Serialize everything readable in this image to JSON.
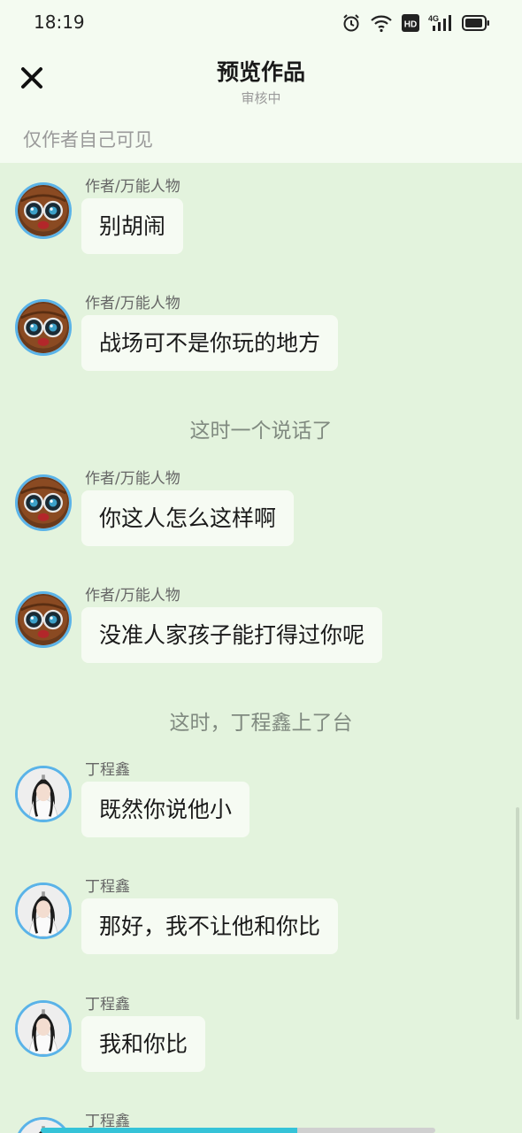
{
  "status_bar": {
    "time": "18:19",
    "icons": [
      "alarm-icon",
      "wifi-icon",
      "hd-icon",
      "signal-4g-icon",
      "battery-icon"
    ],
    "hd_label": "HD",
    "network_label": "4G"
  },
  "header": {
    "close_icon": "close-icon",
    "title": "预览作品",
    "subtitle": "审核中",
    "visibility_note": "仅作者自己可见"
  },
  "colors": {
    "background": "#e3f3dd",
    "header_background": "#f4fbf1",
    "bubble": "#f6fbf3",
    "avatar_ring": "#5ab3e8",
    "progress": "#35c3d8"
  },
  "messages": [
    {
      "type": "chat",
      "sender": "作者/万能人物",
      "avatar": "cartoon-glasses-avatar",
      "text": "别胡闹"
    },
    {
      "type": "chat",
      "sender": "作者/万能人物",
      "avatar": "cartoon-glasses-avatar",
      "text": "战场可不是你玩的地方"
    },
    {
      "type": "narration",
      "text": "这时一个说话了"
    },
    {
      "type": "chat",
      "sender": "作者/万能人物",
      "avatar": "cartoon-glasses-avatar",
      "text": "你这人怎么这样啊"
    },
    {
      "type": "chat",
      "sender": "作者/万能人物",
      "avatar": "cartoon-glasses-avatar",
      "text": "没准人家孩子能打得过你呢"
    },
    {
      "type": "narration",
      "text": "这时，丁程鑫上了台"
    },
    {
      "type": "chat",
      "sender": "丁程鑫",
      "avatar": "costume-portrait-avatar",
      "text": "既然你说他小"
    },
    {
      "type": "chat",
      "sender": "丁程鑫",
      "avatar": "costume-portrait-avatar",
      "text": "那好，我不让他和你比"
    },
    {
      "type": "chat",
      "sender": "丁程鑫",
      "avatar": "costume-portrait-avatar",
      "text": "我和你比"
    },
    {
      "type": "chat",
      "sender": "丁程鑫",
      "avatar": "costume-portrait-avatar",
      "text": ""
    }
  ],
  "progress": {
    "fraction": 0.65
  }
}
